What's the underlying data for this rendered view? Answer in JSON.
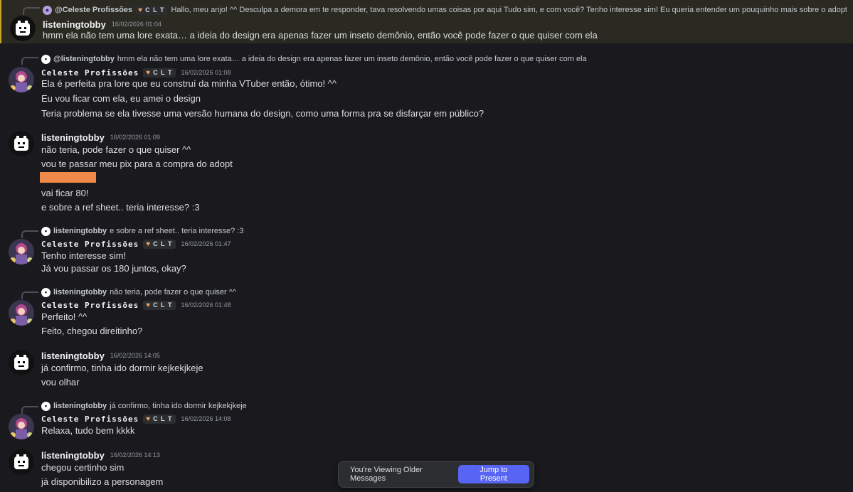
{
  "users": {
    "tobby": {
      "name": "listeningtobby"
    },
    "celeste": {
      "name": "Celeste Profissões",
      "tag": "C L T"
    }
  },
  "messages": [
    {
      "highlighted": true,
      "reply_author": "@Celeste Profissões",
      "reply_tag": "C L T",
      "reply_text": "Hallo, meu anjo! ^^ Desculpa a demora em te responder, tava resolvendo umas coisas por aqui Tudo sim, e com você?  Tenho interesse sim! Eu queria entender um pouquinho mais sobre o adopt, você te…",
      "author": "listeningtobby",
      "time": "16/02/2026 01:04",
      "lines": [
        "hmm ela não tem uma lore exata… a ideia do design era apenas fazer um inseto demônio, então você pode fazer o que quiser com ela"
      ]
    },
    {
      "reply_author": "@listeningtobby",
      "reply_text": "hmm ela não tem uma lore exata… a ideia do design era apenas fazer um inseto demônio, então você pode fazer o que quiser com ela",
      "author": "Celeste Profissões",
      "time": "16/02/2026 01:08",
      "lines": [
        "Ela é perfeita pra lore que eu construí da minha VTuber então, ótimo! ^^",
        "Eu vou ficar com ela, eu amei o design",
        "Teria problema se ela tivesse uma versão humana do design, como uma forma pra se disfarçar em público?"
      ]
    },
    {
      "author": "listeningtobby",
      "time": "16/02/2026 01:09",
      "lines": [
        "não teria, pode fazer o que quiser ^^",
        "vou te passar meu pix para a compra do adopt",
        "vai ficar 80!",
        "e sobre a ref sheet.. teria interesse? :3"
      ]
    },
    {
      "reply_author": "listeningtobby",
      "reply_text": "e sobre a ref sheet.. teria interesse? :3",
      "author": "Celeste Profissões",
      "time": "16/02/2026 01:47",
      "lines": [
        "Tenho interesse sim!",
        "Já vou passar os 180 juntos, okay?"
      ]
    },
    {
      "reply_author": "listeningtobby",
      "reply_text": "não teria, pode fazer o que quiser ^^",
      "author": "Celeste Profissões",
      "time": "16/02/2026 01:48",
      "lines": [
        "Perfeito! ^^",
        "Feito, chegou direitinho?"
      ]
    },
    {
      "author": "listeningtobby",
      "time": "16/02/2026 14:05",
      "lines": [
        "já confirmo, tinha ido dormir kejkekjkeje",
        "vou olhar"
      ]
    },
    {
      "reply_author": "listeningtobby",
      "reply_text": "já confirmo, tinha ido dormir kejkekjkeje",
      "author": "Celeste Profissões",
      "time": "16/02/2026 14:08",
      "lines": [
        "Relaxa, tudo bem kkkk"
      ]
    },
    {
      "author": "listeningtobby",
      "time": "16/02/2026 14:13",
      "lines": [
        "chegou certinho sim",
        "já disponibilizo a personagem"
      ]
    }
  ],
  "banner": {
    "text": "You're Viewing Older Messages",
    "button": "Jump to Present",
    "button_color": "#5865f2"
  },
  "colors": {
    "background": "#1a1a1e",
    "highlight_bg": "#2b2a22",
    "highlight_border": "#c9a227",
    "redaction": "#f08a4b"
  }
}
